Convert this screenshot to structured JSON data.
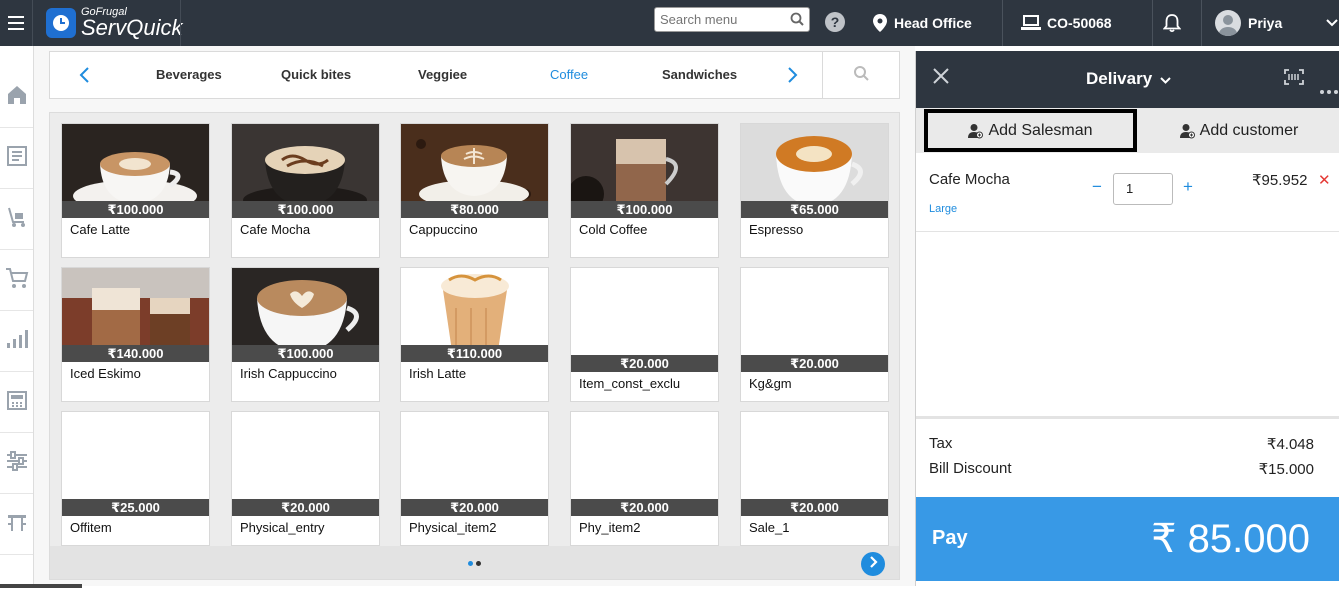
{
  "header": {
    "logo_small": "GoFrugal",
    "logo_big": "ServQuick",
    "search_placeholder": "Search menu",
    "help": "?",
    "location": "Head Office",
    "device": "CO-50068",
    "user": "Priya"
  },
  "categories": {
    "tabs": [
      "Beverages",
      "Quick bites",
      "Veggiee",
      "Coffee",
      "Sandwiches"
    ],
    "active": "Coffee"
  },
  "products": [
    {
      "name": "Cafe Latte",
      "price": "₹100.000"
    },
    {
      "name": "Cafe Mocha",
      "price": "₹100.000"
    },
    {
      "name": "Cappuccino",
      "price": "₹80.000"
    },
    {
      "name": "Cold Coffee",
      "price": "₹100.000"
    },
    {
      "name": "Espresso",
      "price": "₹65.000"
    },
    {
      "name": "Iced Eskimo",
      "price": "₹140.000"
    },
    {
      "name": "Irish Cappuccino",
      "price": "₹100.000"
    },
    {
      "name": "Irish Latte",
      "price": "₹110.000"
    },
    {
      "name": "Item_const_exclu",
      "price": "₹20.000"
    },
    {
      "name": "Kg&gm",
      "price": "₹20.000"
    },
    {
      "name": "Offitem",
      "price": "₹25.000"
    },
    {
      "name": "Physical_entry",
      "price": "₹20.000"
    },
    {
      "name": "Physical_item2",
      "price": "₹20.000"
    },
    {
      "name": "Phy_item2",
      "price": "₹20.000"
    },
    {
      "name": "Sale_1",
      "price": "₹20.000"
    }
  ],
  "order": {
    "mode": "Delivary",
    "add_salesman": "Add Salesman",
    "add_customer": "Add customer",
    "item": {
      "name": "Cafe Mocha",
      "variant": "Large",
      "qty": "1",
      "price": "₹95.952",
      "minus": "−",
      "plus": "+",
      "remove": "✕"
    },
    "tax_label": "Tax",
    "tax_value": "₹4.048",
    "discount_label": "Bill Discount",
    "discount_value": "₹15.000",
    "pay_label": "Pay",
    "pay_amount": "₹ 85.000"
  },
  "colors": {
    "topbar": "#2e3640",
    "accent": "#1f8cde",
    "pay": "#3899e6",
    "remove": "#e53935"
  }
}
